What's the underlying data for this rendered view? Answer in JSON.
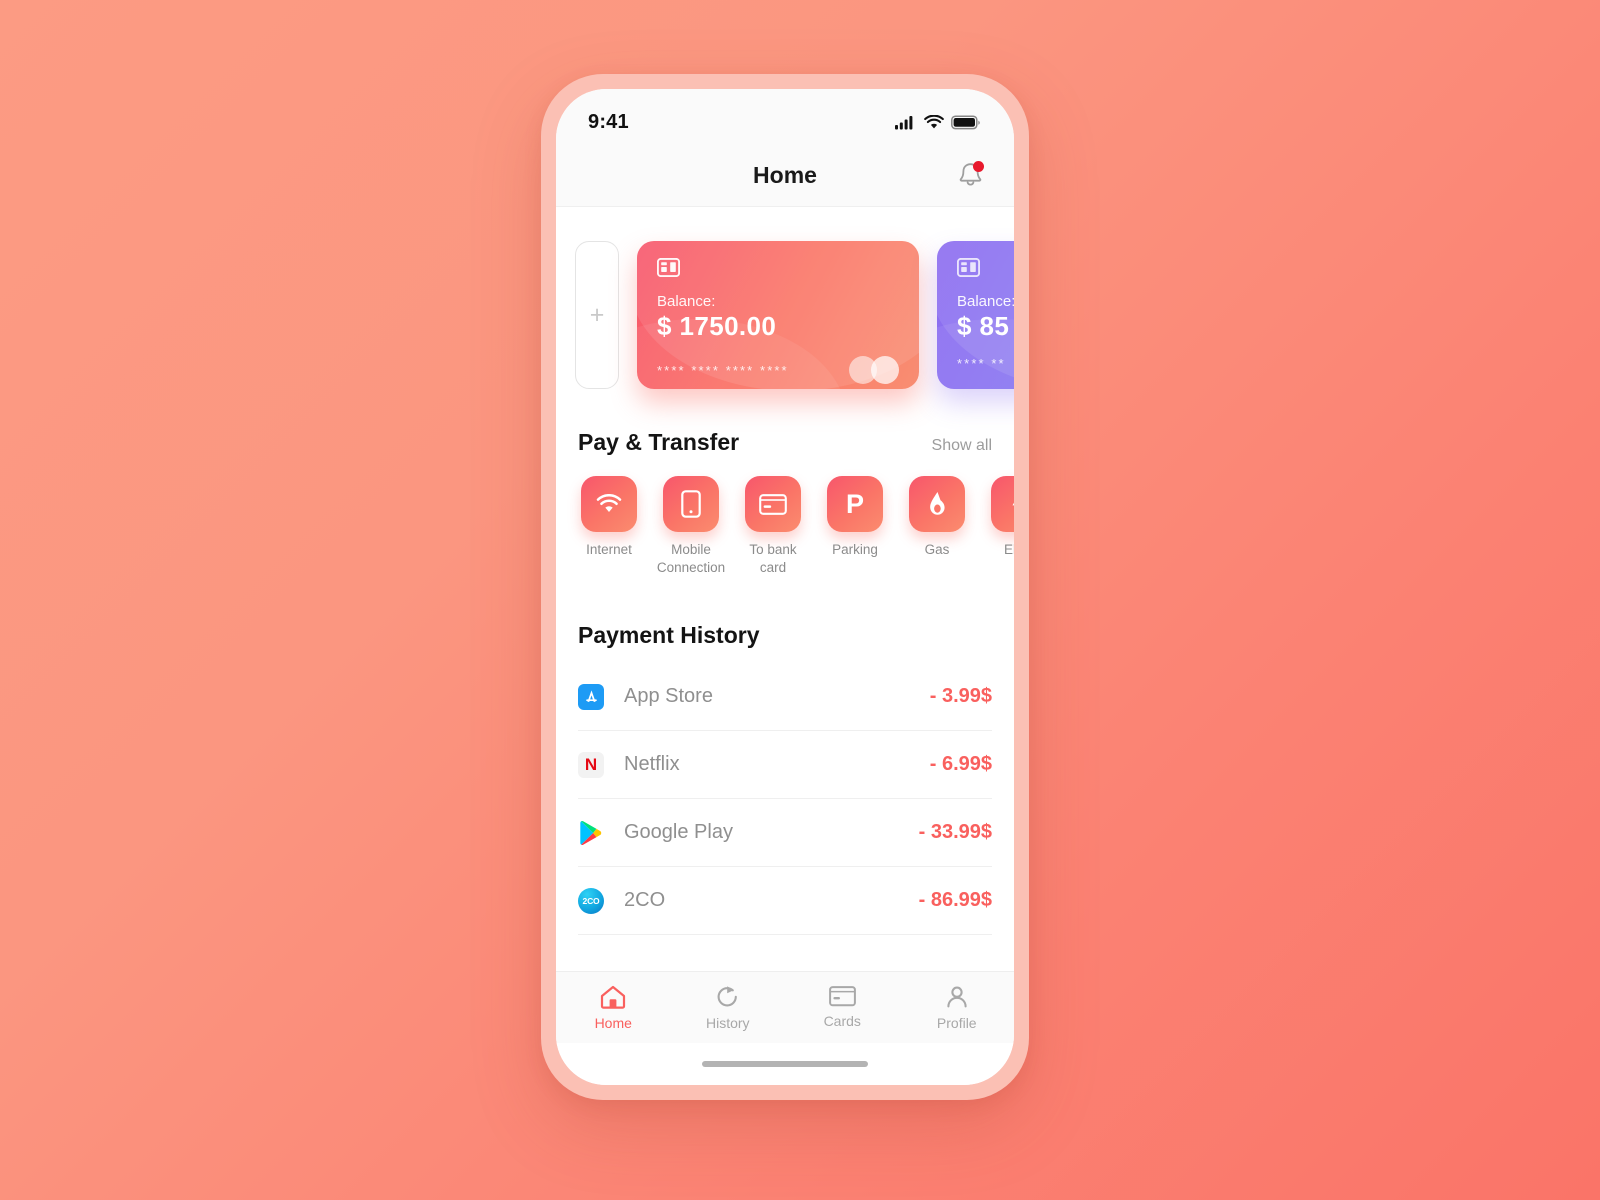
{
  "status_bar": {
    "time": "9:41",
    "signal_icon": "cellular-signal-icon",
    "wifi_icon": "wifi-icon",
    "battery_icon": "battery-full-icon"
  },
  "header": {
    "title": "Home",
    "notification_icon": "bell-icon",
    "has_unread": true,
    "unread_dot_color": "#E8192C"
  },
  "cards": {
    "add_label": "+",
    "items": [
      {
        "balance_label": "Balance:",
        "balance_value": "$ 1750.00",
        "masked_number": "**** **** **** ****",
        "brand": "mastercard",
        "accent": "#FA7566"
      },
      {
        "balance_label": "Balance:",
        "balance_value": "$ 85",
        "masked_number": "**** **",
        "brand": "mastercard",
        "accent": "#8A7BF2"
      }
    ]
  },
  "pay_transfer": {
    "title": "Pay & Transfer",
    "show_all": "Show all",
    "services": [
      {
        "label": "Internet",
        "icon": "wifi-icon"
      },
      {
        "label": "Mobile Connection",
        "icon": "smartphone-icon"
      },
      {
        "label": "To bank card",
        "icon": "credit-card-icon"
      },
      {
        "label": "Parking",
        "icon": "parking-p-icon"
      },
      {
        "label": "Gas",
        "icon": "gas-flame-icon"
      },
      {
        "label": "Elect",
        "icon": "electricity-icon"
      }
    ]
  },
  "payment_history": {
    "title": "Payment History",
    "rows": [
      {
        "name": "App Store",
        "amount": "- 3.99$",
        "icon": "app-store-icon"
      },
      {
        "name": "Netflix",
        "amount": "- 6.99$",
        "icon": "netflix-icon"
      },
      {
        "name": "Google Play",
        "amount": "- 33.99$",
        "icon": "google-play-icon"
      },
      {
        "name": "2CO",
        "amount": "- 86.99$",
        "icon": "2co-icon"
      }
    ],
    "amount_color": "#F9605E"
  },
  "bottom_nav": {
    "items": [
      {
        "label": "Home",
        "icon": "house-icon",
        "active": true
      },
      {
        "label": "History",
        "icon": "clock-rotate-icon",
        "active": false
      },
      {
        "label": "Cards",
        "icon": "credit-card-icon",
        "active": false
      },
      {
        "label": "Profile",
        "icon": "person-icon",
        "active": false
      }
    ],
    "active_color": "#F9605E",
    "inactive_color": "#A8A8A8"
  }
}
